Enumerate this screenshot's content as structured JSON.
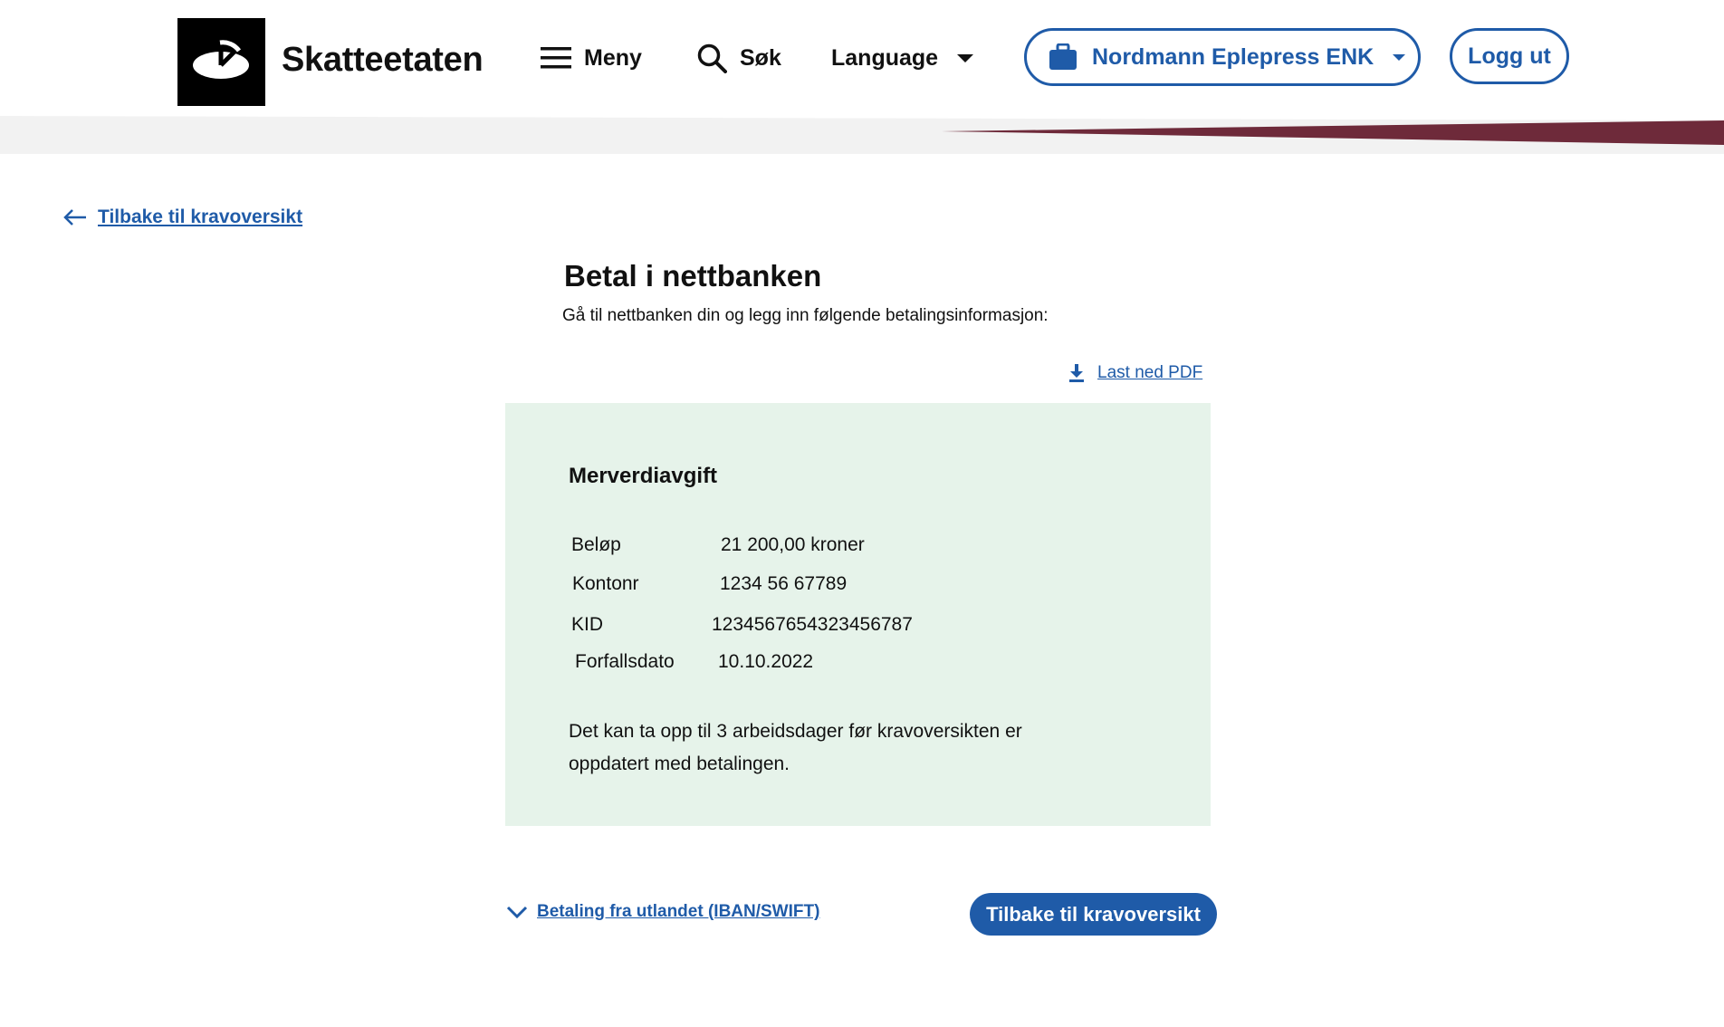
{
  "header": {
    "logo_text": "Skatteetaten",
    "menu_label": "Meny",
    "search_label": "Søk",
    "language_label": "Language",
    "org_name": "Nordmann Eplepress ENK",
    "logout_label": "Logg ut",
    "accent_color": "#1f5ba8",
    "swoosh_color": "#6e2a3a"
  },
  "nav": {
    "back_link": "Tilbake til kravoversikt"
  },
  "main": {
    "title": "Betal i nettbanken",
    "subtitle": "Gå til nettbanken din og legg inn følgende betalingsinformasjon:",
    "pdf_link": "Last ned PDF",
    "panel": {
      "title": "Merverdiavgift",
      "rows": [
        {
          "label": "Beløp",
          "value": "21 200,00 kroner"
        },
        {
          "label": "Kontonr",
          "value": "1234 56 67789"
        },
        {
          "label": "KID",
          "value": "1234567654323456787"
        },
        {
          "label": "Forfallsdato",
          "value": "10.10.2022"
        }
      ],
      "note": "Det kan ta opp til 3 arbeidsdager før kravoversikten er oppdatert med betalingen.",
      "background_color": "#e6f3ea"
    },
    "iban_link": "Betaling fra utlandet (IBAN/SWIFT)",
    "back_button": "Tilbake til kravoversikt"
  }
}
